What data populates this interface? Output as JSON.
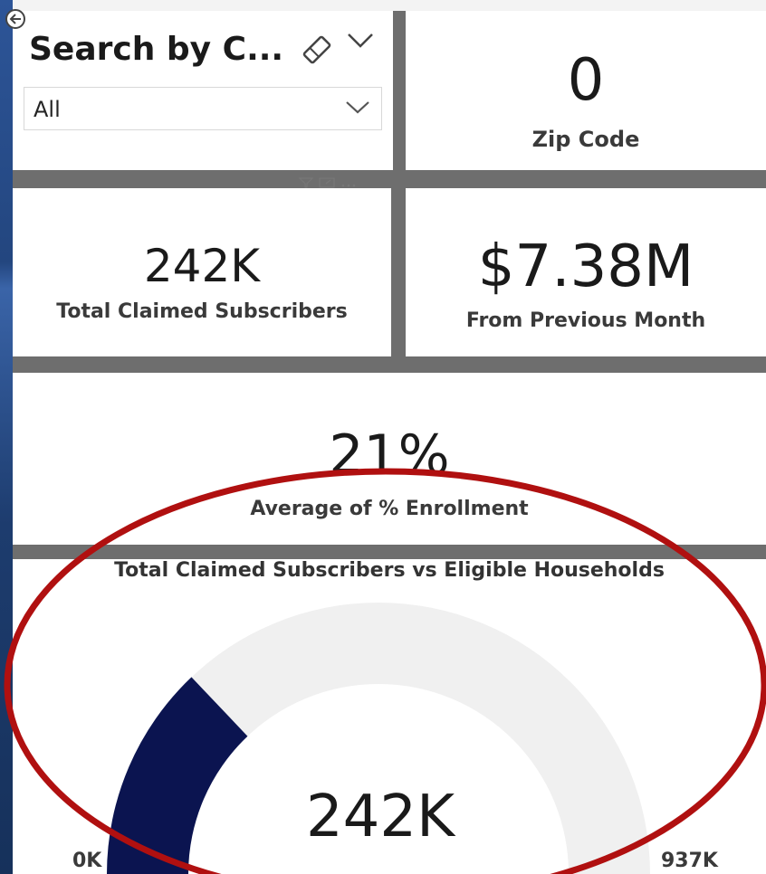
{
  "slicer": {
    "title": "Search by C...",
    "selected": "All"
  },
  "kpis": {
    "zip_code": {
      "value": "0",
      "label": "Zip Code"
    },
    "claimed": {
      "value": "242K",
      "label": "Total Claimed Subscribers"
    },
    "previous_month": {
      "value": "$7.38M",
      "label": "From Previous Month"
    },
    "enrollment": {
      "value": "21%",
      "label": "Average of % Enrollment"
    }
  },
  "gauge": {
    "title": "Total Claimed Subscribers vs Eligible Households",
    "value_label": "242K",
    "min_label": "0K",
    "max_label": "937K",
    "value": 242,
    "min": 0,
    "max": 937,
    "fill_color": "#0b1450",
    "track_color": "#f0f0f0"
  },
  "colors": {
    "annotation_circle": "#b01010"
  },
  "icons": [
    "back-arrow-icon",
    "eraser-icon",
    "chevron-down-icon",
    "filter-icon",
    "focus-mode-icon",
    "more-options-icon"
  ]
}
